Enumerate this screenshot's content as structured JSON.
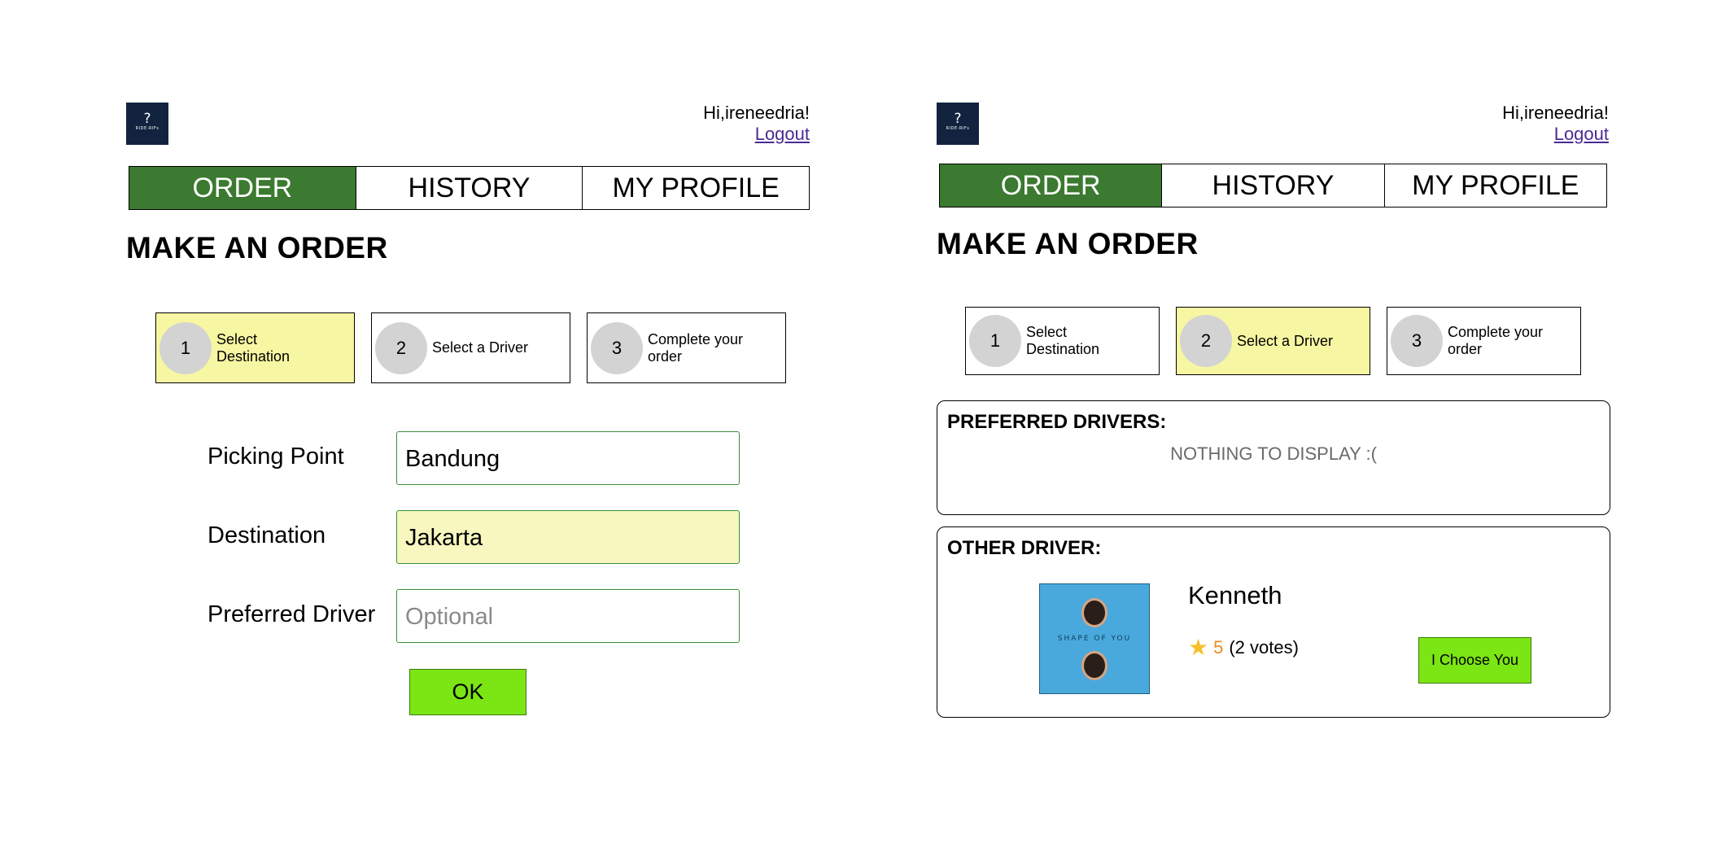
{
  "left_panel": {
    "logo": {
      "mark": "?",
      "caption": "RIDE-RIFs"
    },
    "greeting": "Hi,ireneedria!",
    "logout": "Logout",
    "tabs": [
      {
        "label": "ORDER",
        "active": true
      },
      {
        "label": "HISTORY",
        "active": false
      },
      {
        "label": "MY PROFILE",
        "active": false
      }
    ],
    "title": "MAKE AN ORDER",
    "steps": [
      {
        "num": "1",
        "label": "Select Destination",
        "active": true
      },
      {
        "num": "2",
        "label": "Select a Driver",
        "active": false
      },
      {
        "num": "3",
        "label": "Complete your order",
        "active": false
      }
    ],
    "form": {
      "picking_label": "Picking Point",
      "picking_value": "Bandung",
      "destination_label": "Destination",
      "destination_value": "Jakarta",
      "driver_label": "Preferred Driver",
      "driver_placeholder": "Optional",
      "ok_label": "OK"
    }
  },
  "right_panel": {
    "logo": {
      "mark": "?",
      "caption": "RIDE-RIFs"
    },
    "greeting": "Hi,ireneedria!",
    "logout": "Logout",
    "tabs": [
      {
        "label": "ORDER",
        "active": true
      },
      {
        "label": "HISTORY",
        "active": false
      },
      {
        "label": "MY PROFILE",
        "active": false
      }
    ],
    "title": "MAKE AN ORDER",
    "steps": [
      {
        "num": "1",
        "label": "Select Destination",
        "active": false
      },
      {
        "num": "2",
        "label": "Select a Driver",
        "active": true
      },
      {
        "num": "3",
        "label": "Complete your order",
        "active": false
      }
    ],
    "preferred": {
      "heading": "PREFERRED DRIVERS:",
      "empty_text": "NOTHING TO DISPLAY :("
    },
    "other": {
      "heading": "OTHER DRIVER:",
      "driver": {
        "name": "Kenneth",
        "photo_caption": "SHAPE OF YOU",
        "rating": "5",
        "votes": "(2 votes)",
        "choose_label": "I Choose You"
      }
    }
  },
  "colors": {
    "active_tab": "#3b7a30",
    "active_step": "#f7f7a3",
    "button_green": "#7ce514",
    "input_border": "#3a8f3a",
    "rating_orange": "#f08a1a",
    "star": "#f6c12b",
    "link": "#4b2a92"
  }
}
